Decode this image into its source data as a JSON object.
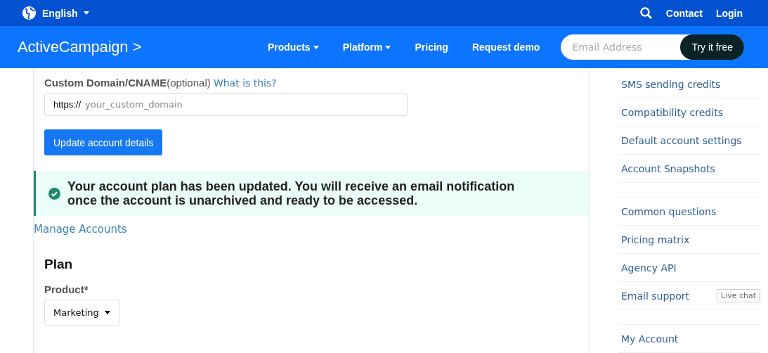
{
  "top_bar": {
    "language": "English",
    "links": [
      "Contact",
      "Login"
    ]
  },
  "nav": {
    "logo": "ActiveCampaign",
    "arrow": ">",
    "items": [
      {
        "label": "Products",
        "dropdown": true
      },
      {
        "label": "Platform",
        "dropdown": true
      },
      {
        "label": "Pricing",
        "dropdown": false
      },
      {
        "label": "Request demo",
        "dropdown": false
      }
    ],
    "email_placeholder": "Email Address",
    "cta": "Try it free"
  },
  "form": {
    "label": "Custom Domain/CNAME",
    "optional": "(optional)",
    "help_link": "What is this?",
    "prefix": "https://",
    "placeholder": "your_custom_domain",
    "button": "Update account details"
  },
  "alert": {
    "kind": "success",
    "message": "Your account plan has been updated. You will receive an email notification once the account is unarchived and ready to be accessed."
  },
  "manage_link": "Manage Accounts",
  "plan": {
    "heading": "Plan",
    "product_label": "Product*",
    "product_value": "Marketing"
  },
  "sidebar": {
    "groups": [
      {
        "items": [
          {
            "label": "SMS sending credits"
          },
          {
            "label": "Compatibility credits"
          },
          {
            "label": "Default account settings"
          },
          {
            "label": "Account Snapshots"
          }
        ]
      },
      {
        "items": [
          {
            "label": "Common questions"
          },
          {
            "label": "Pricing matrix"
          },
          {
            "label": "Agency API"
          },
          {
            "label": "Email support",
            "badge": "Live chat"
          }
        ]
      },
      {
        "items": [
          {
            "label": "My Account"
          }
        ]
      }
    ]
  }
}
